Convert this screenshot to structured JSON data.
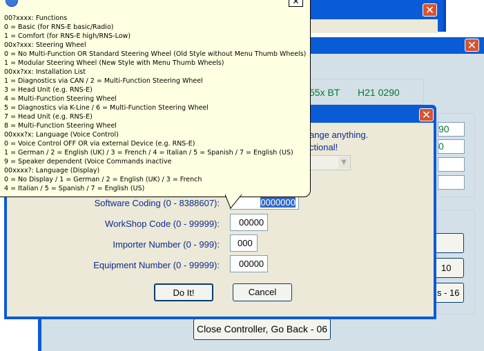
{
  "background_window": {
    "close_glyph": "✕",
    "device_text": "55x BT",
    "part_number": "H21 0290",
    "right_field_1": "90",
    "right_field_2": "0",
    "right_button_1": "10",
    "right_button_2": "s - 16"
  },
  "back_button": {
    "label": "Close Controller, Go Back - 06"
  },
  "dialog": {
    "close_glyph": "✕",
    "warning_line_1": "ange anything.",
    "warning_line_2": "ctional!",
    "fields": [
      {
        "label": "Software Coding (0 - 8388607):",
        "value": "0000000"
      },
      {
        "label": "WorkShop Code (0 - 99999):",
        "value": "00000"
      },
      {
        "label": "Importer Number (0 - 999):",
        "value": "000"
      },
      {
        "label": "Equipment Number (0 - 99999):",
        "value": "00000"
      }
    ],
    "do_it_label": "Do It!",
    "cancel_label": "Cancel"
  },
  "tooltip": {
    "close_glyph": "✕",
    "lines": [
      "00?xxxx: Functions",
      "0 = Basic (for RNS-E basic/Radio)",
      "1 = Comfort (for RNS-E high/RNS-Low)",
      "00x?xxx: Steering Wheel",
      "0 = No Multi-Function OR Standard Steering Wheel (Old Style without Menu Thumb Wheels)",
      "1 = Modular Steering Wheel (New Style with Menu Thumb Wheels)",
      "00xx?xx: Installation List",
      "1 = Diagnostics via CAN / 2 = Multi-Function Steering Wheel",
      "3 = Head Unit (e.g. RNS-E)",
      "4 = Multi-Function Steering Wheel",
      "5 = Diagnostics via K-Line / 6 = Multi-Function Steering Wheel",
      "7 = Head Unit (e.g. RNS-E)",
      "8 = Multi-Function Steering Wheel",
      "00xxx?x: Language (Voice Control)",
      "0 = Voice Control OFF OR via external Device (e.g. RNS-E)",
      "1 = German / 2 = English (UK) / 3 = French / 4 = Italian / 5 = Spanish / 7 = English (US)",
      "9 = Speaker dependent (Voice Commands inactive",
      "00xxxx?: Language (Display)",
      "0 = No Display / 1 = German / 2 = English (UK) / 3 = French",
      "4 = Italian / 5 = Spanish / 7 = English (US)"
    ]
  }
}
